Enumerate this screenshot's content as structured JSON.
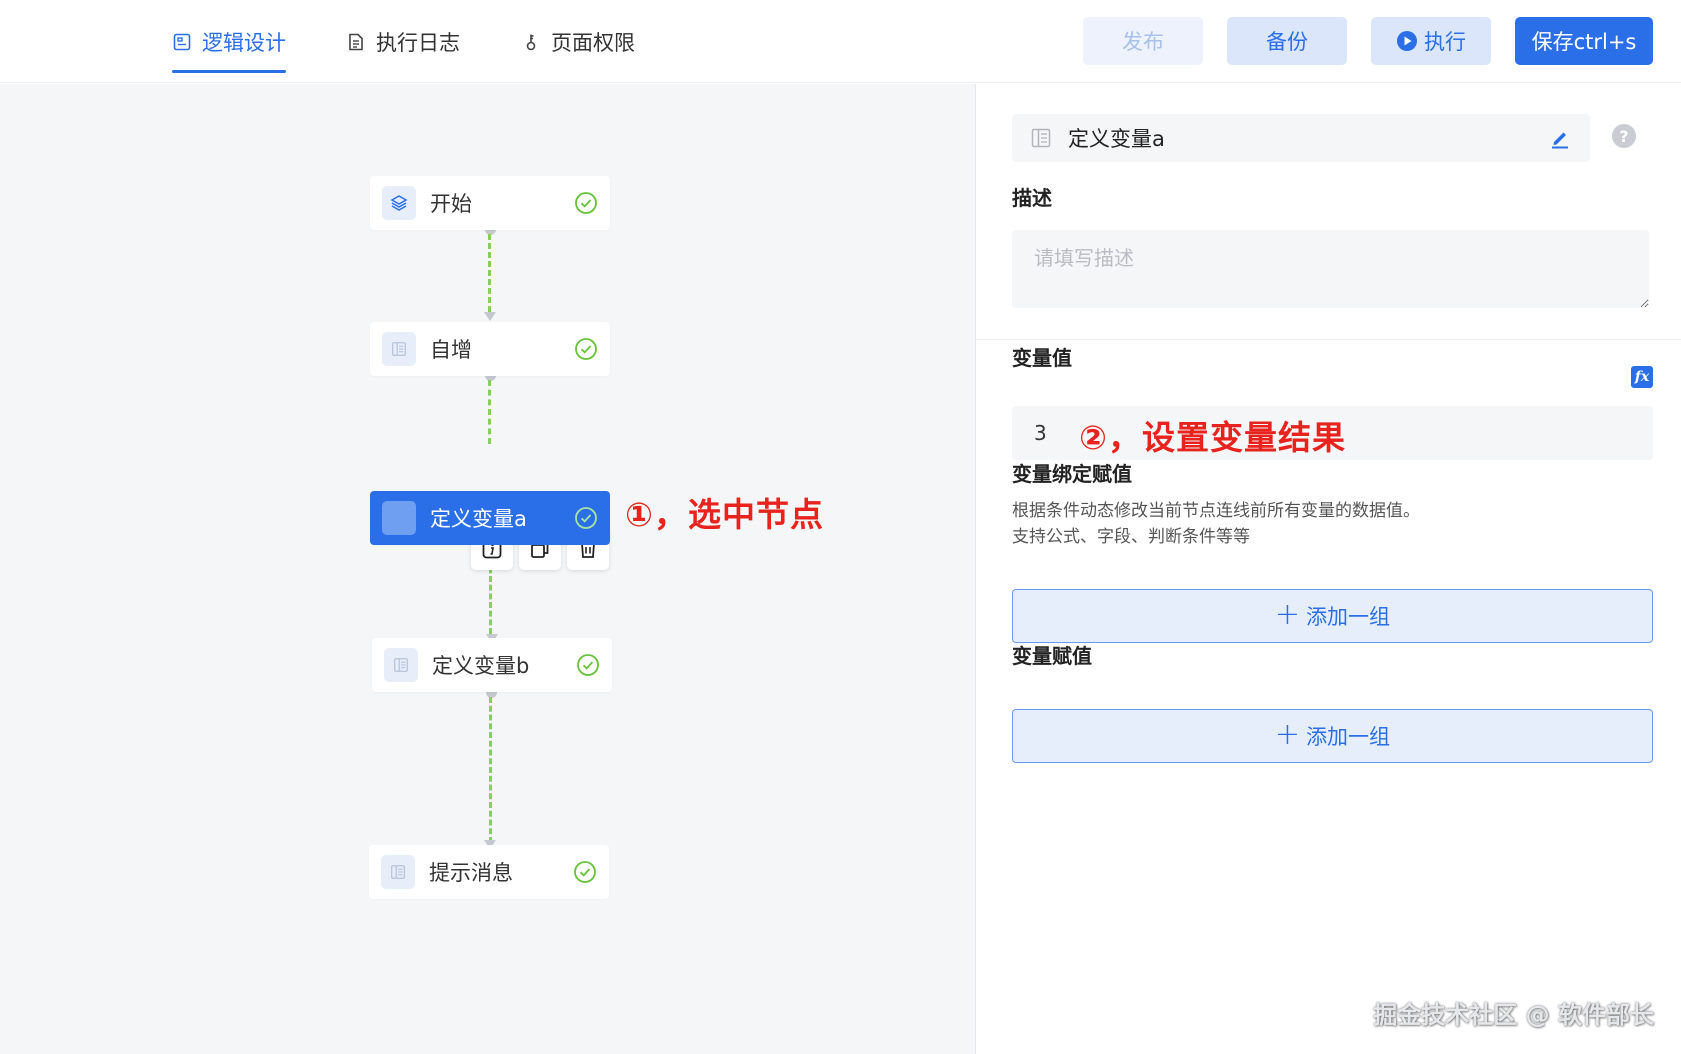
{
  "tabs": [
    {
      "label": "逻辑设计",
      "icon": "logic-design-icon",
      "active": true
    },
    {
      "label": "执行日志",
      "icon": "document-icon",
      "active": false
    },
    {
      "label": "页面权限",
      "icon": "key-icon",
      "active": false
    }
  ],
  "toolbar": {
    "publish_label": "发布",
    "backup_label": "备份",
    "execute_label": "执行",
    "save_label": "保存ctrl+s"
  },
  "nodes": [
    {
      "label": "开始",
      "icon": "layers-icon",
      "status": "check-icon"
    },
    {
      "label": "自增",
      "icon": "table-icon",
      "status": "check-icon"
    },
    {
      "label": "定义变量a",
      "icon": "table-icon",
      "status": "check-icon",
      "selected": true
    },
    {
      "label": "定义变量b",
      "icon": "table-icon",
      "status": "check-icon"
    },
    {
      "label": "提示消息",
      "icon": "table-icon",
      "status": "check-icon"
    }
  ],
  "node_tools": [
    "info-icon",
    "copy-icon",
    "delete-icon"
  ],
  "annotations": {
    "step1": "①，选中节点",
    "step2": "②，设置变量结果"
  },
  "panel": {
    "node_name": "定义变量a",
    "help_label": "?",
    "description_title": "描述",
    "description_placeholder": "请填写描述",
    "value_title": "变量值",
    "fx_label": "fx",
    "value": "3",
    "binding_title": "变量绑定赋值",
    "binding_help_1": "根据条件动态修改当前节点连线前所有变量的数据值。",
    "binding_help_2": "支持公式、字段、判断条件等等",
    "add_group_label": "添加一组",
    "assign_title": "变量赋值"
  },
  "colors": {
    "accent": "#2a6fe8",
    "success": "#67c23a",
    "annotation": "#e8231d",
    "connector": "#86cf5a"
  },
  "watermark": "掘金技术社区 @ 软件部长"
}
